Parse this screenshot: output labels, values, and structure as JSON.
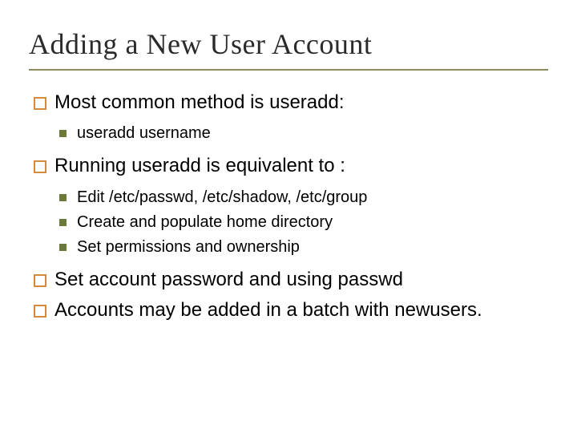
{
  "title": "Adding a New User Account",
  "items": [
    {
      "text": "Most common method is useradd:",
      "children": [
        {
          "text": "useradd username"
        }
      ]
    },
    {
      "text": "Running useradd is equivalent to :",
      "children": [
        {
          "text": "Edit /etc/passwd, /etc/shadow, /etc/group"
        },
        {
          "text": "Create and populate home directory"
        },
        {
          "text": "Set permissions and ownership"
        }
      ]
    },
    {
      "text": "Set account password and using passwd"
    },
    {
      "text": "Accounts may be added in a batch with newusers."
    }
  ]
}
